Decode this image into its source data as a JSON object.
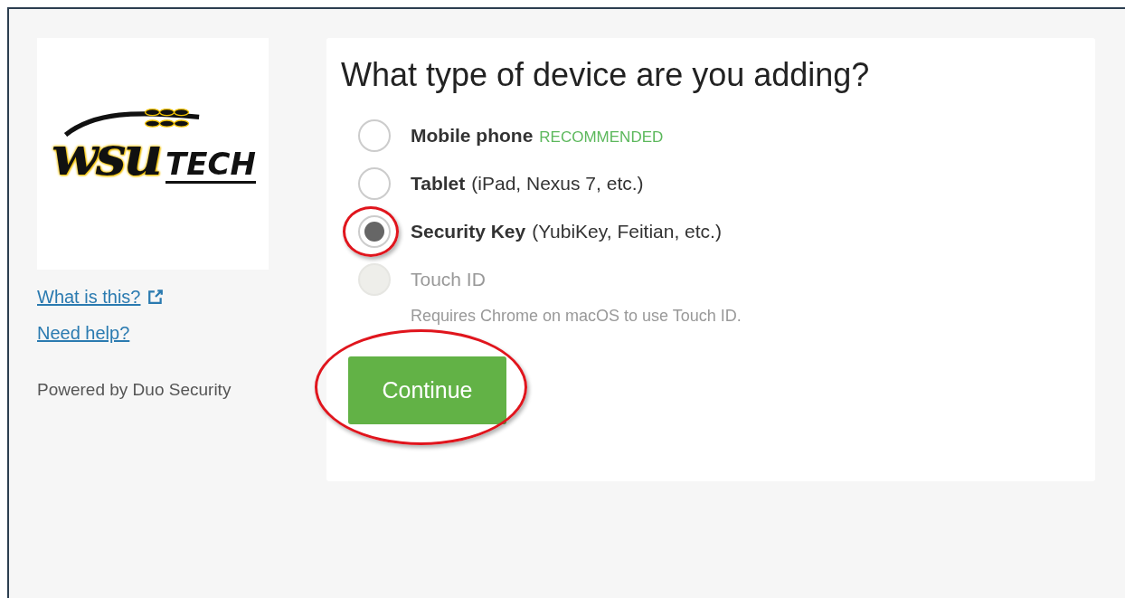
{
  "logo": {
    "script": "wsu",
    "word": "TECH"
  },
  "links": [
    {
      "label": "What is this?",
      "external": true
    },
    {
      "label": "Need help?",
      "external": false
    }
  ],
  "powered_by": "Powered by Duo Security",
  "title": "What type of device are you adding?",
  "options": [
    {
      "label": "Mobile phone",
      "badge": "RECOMMENDED",
      "selected": false,
      "disabled": false,
      "highlighted": false
    },
    {
      "label": "Tablet",
      "detail": "(iPad, Nexus 7, etc.)",
      "selected": false,
      "disabled": false,
      "highlighted": false
    },
    {
      "label": "Security Key",
      "detail": "(YubiKey, Feitian, etc.)",
      "selected": true,
      "disabled": false,
      "highlighted": true
    },
    {
      "label": "Touch ID",
      "note": "Requires Chrome on macOS to use Touch ID.",
      "selected": false,
      "disabled": true,
      "highlighted": false
    }
  ],
  "continue_button": {
    "label": "Continue",
    "highlighted": true
  }
}
